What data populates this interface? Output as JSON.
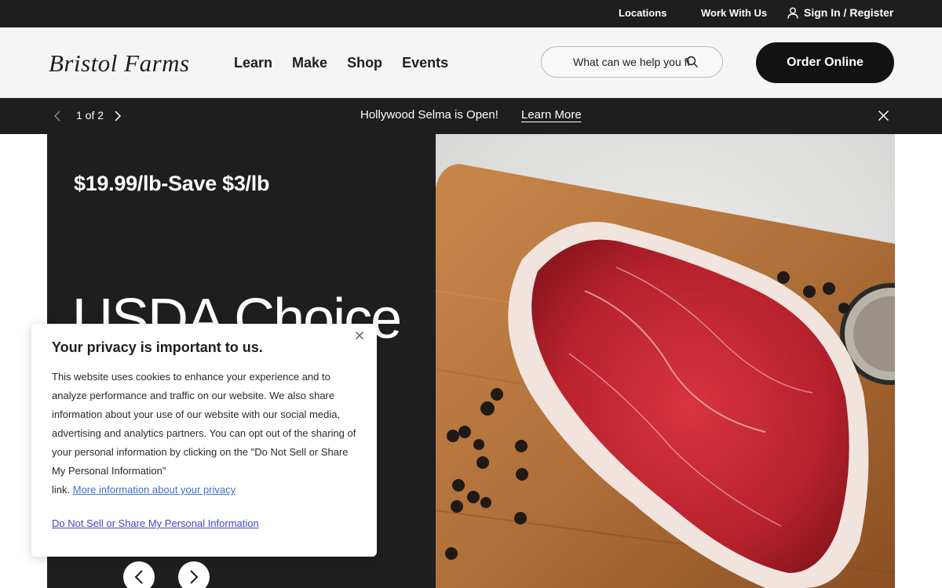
{
  "utility": {
    "locations": "Locations",
    "work_with_us": "Work With Us",
    "sign_in": "Sign In / Register"
  },
  "header": {
    "logo": "Bristol Farms",
    "nav": [
      "Learn",
      "Make",
      "Shop",
      "Events"
    ],
    "search_placeholder": "What can we help you fi",
    "order_button": "Order Online"
  },
  "announcement": {
    "counter": "1 of 2",
    "text": "Hollywood Selma is Open!",
    "link": "Learn More"
  },
  "hero": {
    "price": "$19.99/lb-Save $3/lb",
    "title": "USDA Choice"
  },
  "privacy": {
    "title": "Your privacy is important to us.",
    "body": "This website uses cookies to enhance your experience and to analyze performance and traffic on our website. We also share information about your use of our website with our social media, advertising and analytics partners. You can opt out of the sharing of your personal information by clicking on the \"Do Not Sell or Share My Personal Information\"",
    "link_prefix": "link.",
    "more_info_link": "More information about your privacy",
    "do_not_sell": "Do Not Sell or Share My Personal Information"
  },
  "colors": {
    "dark": "#1e1e1e",
    "header_bg": "#f5f5f5",
    "link_blue": "#3b6fc9"
  }
}
